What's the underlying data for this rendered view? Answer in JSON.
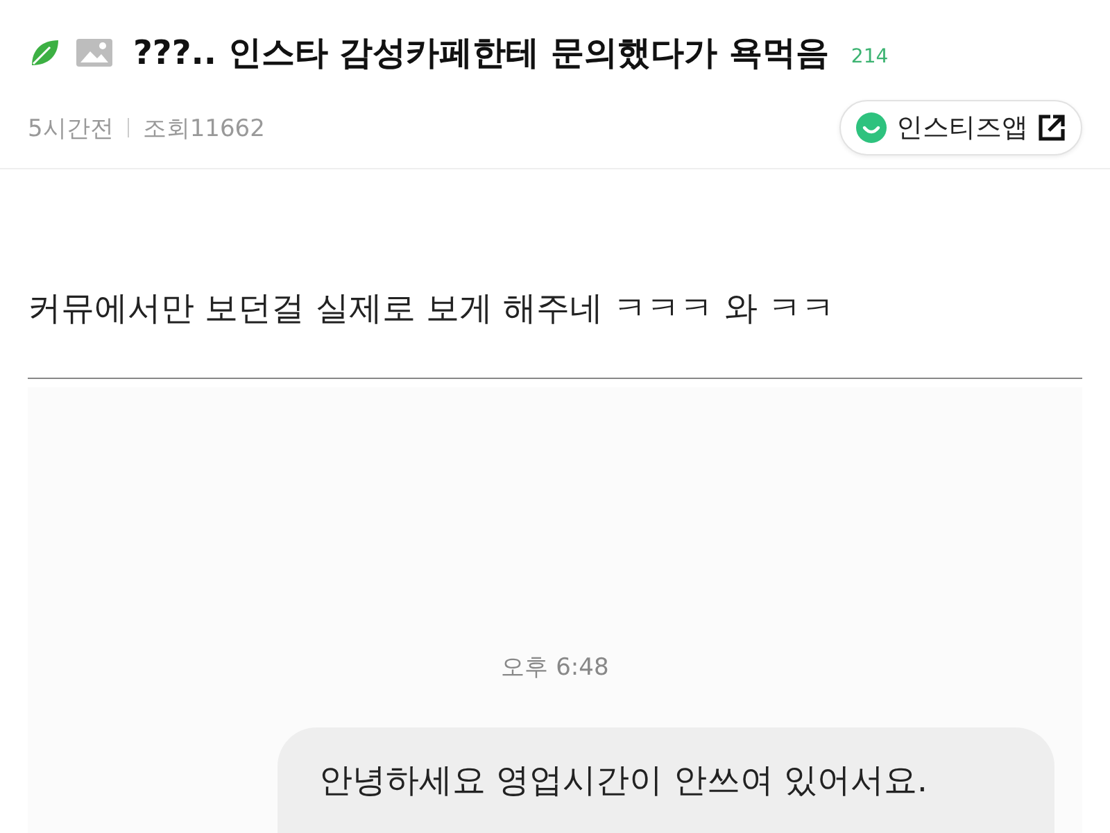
{
  "post": {
    "title": "???.. 인스타 감성카페한테 문의했다가 욕먹음",
    "comment_count": "214",
    "time": "5시간전",
    "views": "조회11662",
    "app_button": "인스티즈앱"
  },
  "body": {
    "text": "커뮤에서만 보던걸 실제로 보게 해주네 ㅋㅋㅋ 와 ㅋㅋ"
  },
  "chat_screenshot": {
    "timestamp": "오후 6:48",
    "message": "안녕하세요 영업시간이 안쓰여 있어서요."
  }
}
